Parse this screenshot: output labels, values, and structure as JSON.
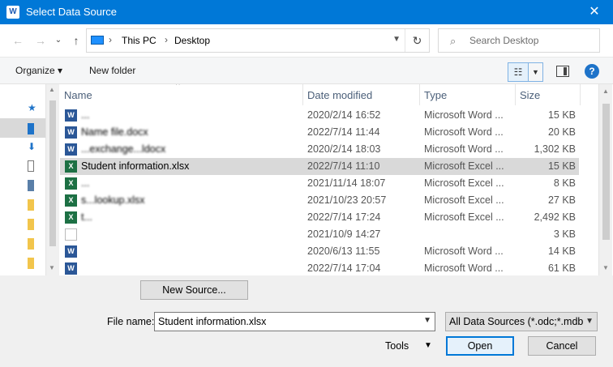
{
  "window": {
    "title": "Select Data Source",
    "app_icon": "word-icon",
    "close_glyph": "✕"
  },
  "nav": {
    "back_glyph": "←",
    "forward_glyph": "→",
    "recent_glyph": "⌄",
    "up_glyph": "↑",
    "breadcrumbs": [
      "This PC",
      "Desktop"
    ],
    "separator": "›",
    "refresh_glyph": "↻",
    "search_placeholder": "Search Desktop"
  },
  "toolbar": {
    "organize_label": "Organize ▾",
    "new_folder_label": "New folder",
    "view_glyph": "☷",
    "view_dd_glyph": "▼",
    "help_label": "?"
  },
  "columns": {
    "name": "Name",
    "date": "Date modified",
    "type": "Type",
    "size": "Size",
    "sort_glyph": "^"
  },
  "files": [
    {
      "icon": "word",
      "name": "...",
      "date": "2020/2/14 16:52",
      "type": "Microsoft Word ...",
      "size": "15 KB",
      "obscured": true
    },
    {
      "icon": "word",
      "name": "Name file.docx",
      "date": "2022/7/14 11:44",
      "type": "Microsoft Word ...",
      "size": "20 KB",
      "obscured": true
    },
    {
      "icon": "word",
      "name": "...exchange...ldocx",
      "date": "2020/2/14 18:03",
      "type": "Microsoft Word ...",
      "size": "1,302 KB",
      "obscured": true
    },
    {
      "icon": "excel",
      "name": "Student information.xlsx",
      "date": "2022/7/14 11:10",
      "type": "Microsoft Excel ...",
      "size": "15 KB",
      "obscured": false,
      "selected": true
    },
    {
      "icon": "excel",
      "name": "...",
      "date": "2021/11/14 18:07",
      "type": "Microsoft Excel ...",
      "size": "8 KB",
      "obscured": true
    },
    {
      "icon": "excel",
      "name": "s...lookup.xlsx",
      "date": "2021/10/23 20:57",
      "type": "Microsoft Excel ...",
      "size": "27 KB",
      "obscured": true
    },
    {
      "icon": "excel",
      "name": "t...",
      "date": "2022/7/14 17:24",
      "type": "Microsoft Excel ...",
      "size": "2,492 KB",
      "obscured": true
    },
    {
      "icon": "blank",
      "name": "",
      "date": "2021/10/9 14:27",
      "type": "",
      "size": "3 KB",
      "obscured": true
    },
    {
      "icon": "word",
      "name": "",
      "date": "2020/6/13 11:55",
      "type": "Microsoft Word ...",
      "size": "14 KB",
      "obscured": true
    },
    {
      "icon": "word",
      "name": "",
      "date": "2022/7/14 17:04",
      "type": "Microsoft Word ...",
      "size": "61 KB",
      "obscured": true
    }
  ],
  "bottom": {
    "new_source_label": "New Source...",
    "file_name_label": "File name:",
    "file_name_value": "Student information.xlsx",
    "filter_value": "All Data Sources (*.odc;*.mdb;*",
    "tools_label": "Tools",
    "open_label": "Open",
    "cancel_label": "Cancel",
    "dropdown_glyph": "▼"
  }
}
